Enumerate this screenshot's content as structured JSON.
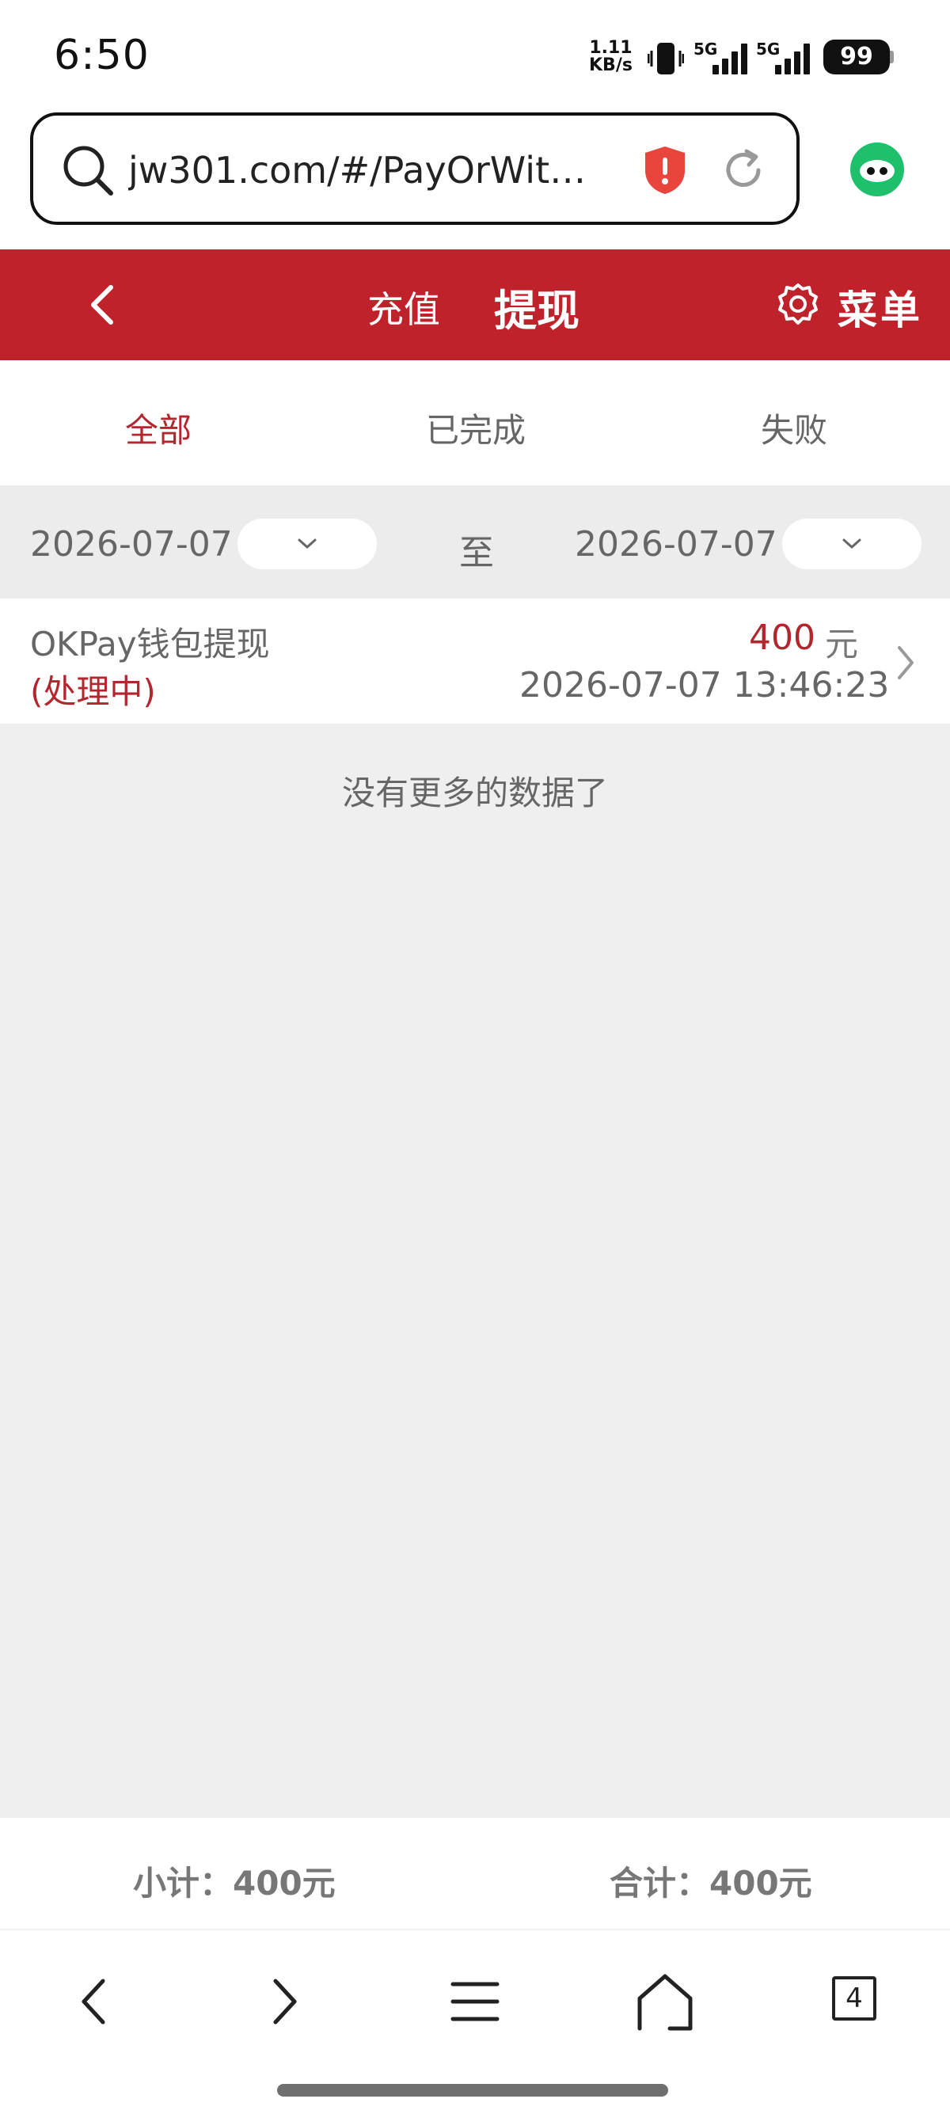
{
  "status_bar": {
    "time": "6:50",
    "net_speed_value": "1.11",
    "net_speed_unit": "KB/s",
    "network_label_1": "5G",
    "network_label_2": "5G",
    "battery": "99"
  },
  "browser": {
    "url": "jw301.com/#/PayOrWithd…"
  },
  "header": {
    "recharge_label": "充值",
    "withdraw_label": "提现",
    "menu_label": "菜单"
  },
  "tabs": [
    {
      "label": "全部",
      "active": true
    },
    {
      "label": "已完成",
      "active": false
    },
    {
      "label": "失败",
      "active": false
    }
  ],
  "filter": {
    "start_date": "2026-07-07",
    "separator": "至",
    "end_date": "2026-07-07"
  },
  "records": [
    {
      "title": "OKPay钱包提现",
      "status": "(处理中)",
      "amount": "400",
      "currency": "元",
      "datetime": "2026-07-07 13:46:23"
    }
  ],
  "no_more_text": "没有更多的数据了",
  "summary": {
    "subtotal": "小计：400元",
    "total": "合计：400元"
  },
  "nav": {
    "tabs_count": "4"
  },
  "colors": {
    "brand_red": "#c0222b",
    "text_red": "#b3262d",
    "shield_red": "#e8463c",
    "logo_green": "#1fc06b"
  }
}
